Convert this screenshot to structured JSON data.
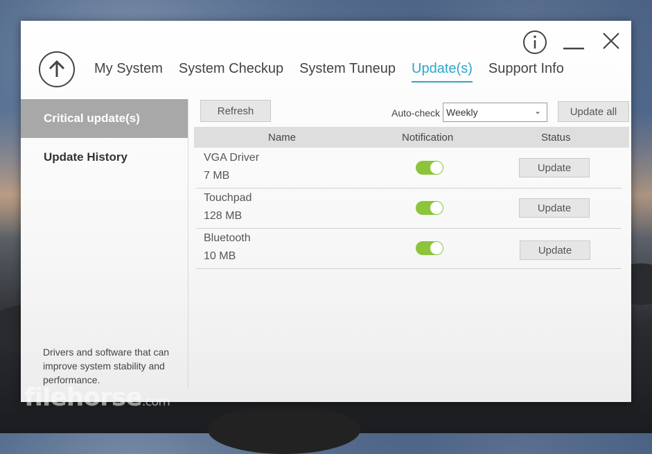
{
  "window_controls": {
    "info_icon": "info-icon",
    "minimize_icon": "minimize-icon",
    "close_icon": "close-icon"
  },
  "logo_icon": "arrow-up-icon",
  "tabs": [
    {
      "label": "My System",
      "active": false
    },
    {
      "label": "System Checkup",
      "active": false
    },
    {
      "label": "System Tuneup",
      "active": false
    },
    {
      "label": "Update(s)",
      "active": true
    },
    {
      "label": "Support Info",
      "active": false
    }
  ],
  "sidebar": {
    "items": [
      {
        "label": "Critical update(s)",
        "active": true
      },
      {
        "label": "Update History",
        "active": false
      }
    ],
    "description": "Drivers and software that can improve system stability and performance."
  },
  "toolbar": {
    "refresh_label": "Refresh",
    "autocheck_label": "Auto-check",
    "autocheck_value": "Weekly",
    "update_all_label": "Update all"
  },
  "table": {
    "headers": {
      "name": "Name",
      "notification": "Notification",
      "status": "Status"
    },
    "rows": [
      {
        "name": "VGA Driver",
        "size": "7 MB",
        "notification_on": true,
        "action": "Update"
      },
      {
        "name": "Touchpad",
        "size": "128 MB",
        "notification_on": true,
        "action": "Update"
      },
      {
        "name": "Bluetooth",
        "size": "10 MB",
        "notification_on": true,
        "action": "Update"
      }
    ]
  },
  "watermark": {
    "brand": "filehorse",
    "domain": ".com"
  },
  "colors": {
    "accent": "#2aa6c8",
    "toggle_on": "#8cc43a",
    "sidebar_active": "#a8a8a8"
  }
}
